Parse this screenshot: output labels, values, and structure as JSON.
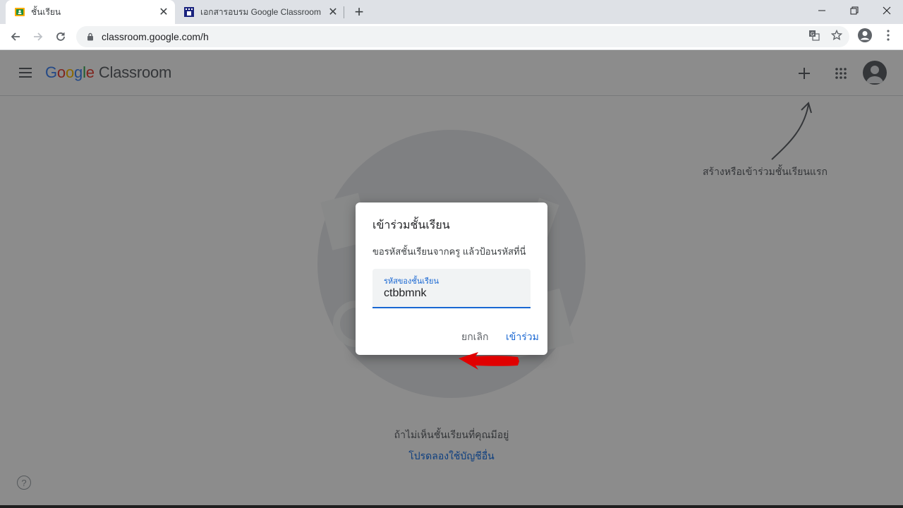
{
  "browser": {
    "tabs": [
      {
        "title": "ชั้นเรียน",
        "active": true
      },
      {
        "title": "เอกสารอบรม Google Classroom",
        "active": false
      }
    ],
    "url": "classroom.google.com/h"
  },
  "app": {
    "logo_google": [
      "G",
      "o",
      "o",
      "g",
      "l",
      "e"
    ],
    "logo_product": "Classroom"
  },
  "main": {
    "hint": "สร้างหรือเข้าร่วมชั้นเรียนแรก",
    "no_class_text": "ถ้าไม่เห็นชั้นเรียนที่คุณมีอยู่",
    "other_account_link": "โปรดลองใช้บัญชีอื่น",
    "help": "?"
  },
  "dialog": {
    "title": "เข้าร่วมชั้นเรียน",
    "body": "ขอรหัสชั้นเรียนจากครู แล้วป้อนรหัสที่นี่",
    "field_label": "รหัสของชั้นเรียน",
    "field_value": "ctbbmnk",
    "cancel_label": "ยกเลิก",
    "join_label": "เข้าร่วม"
  },
  "colors": {
    "accent": "#1967d2",
    "annotation_arrow": "#e00000"
  }
}
